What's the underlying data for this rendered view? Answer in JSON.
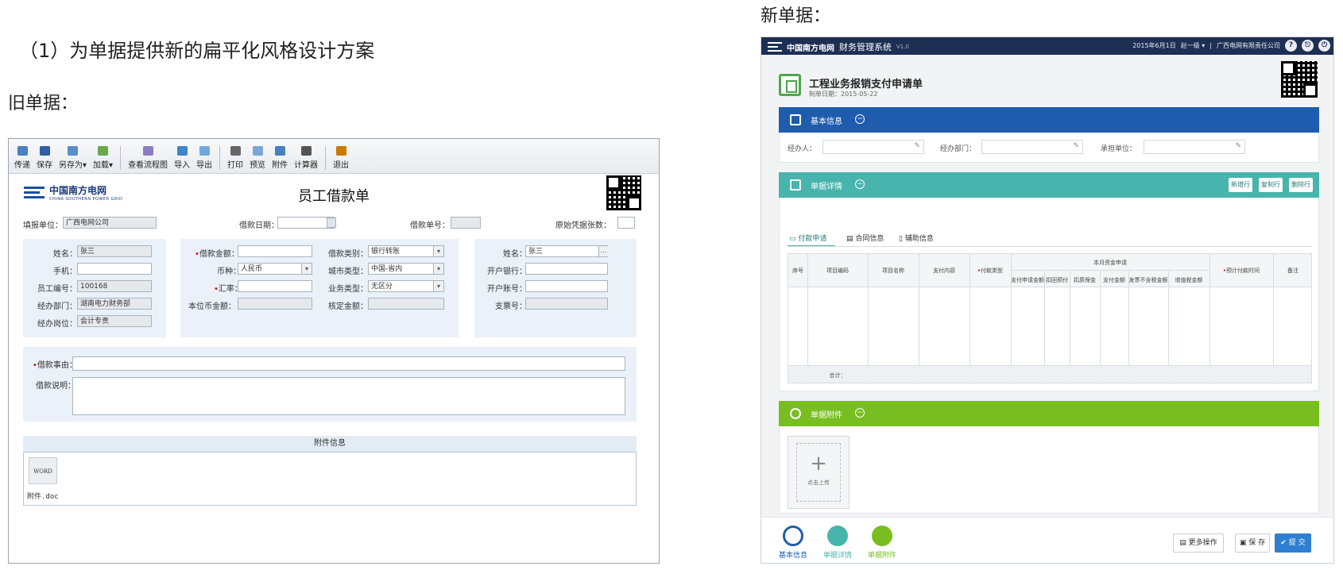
{
  "headings": {
    "main": "（1）为单据提供新的扁平化风格设计方案",
    "old_label": "旧单据：",
    "new_label": "新单据："
  },
  "old_form": {
    "toolbar": [
      "传递",
      "保存",
      "另存为▾",
      "加载▾",
      "查看流程图",
      "导入",
      "导出",
      "打印",
      "预览",
      "附件",
      "计算器",
      "退出"
    ],
    "logo_text": "中国南方电网",
    "logo_sub": "CHINA SOUTHERN POWER GRID",
    "title": "员工借款单",
    "header": {
      "unit_label": "填报单位：",
      "unit_value": "广西电网公司",
      "date_label": "借款日期：",
      "number_label": "借款单号：",
      "voucher_label": "原始凭据张数："
    },
    "left_panel": {
      "name_label": "姓名：",
      "name_value": "张三",
      "phone_label": "手机：",
      "empno_label": "员工编号：",
      "empno_value": "100168",
      "dept_label": "经办部门：",
      "dept_value": "湖南电力财务部",
      "post_label": "经办岗位：",
      "post_value": "会计专责"
    },
    "mid_panel": {
      "amount_label": "借款金额：",
      "type_label": "借款类别：",
      "type_value": "银行转账",
      "currency_label": "币种：",
      "currency_value": "人民币",
      "city_label": "城市类型：",
      "city_value": "中国-省内",
      "rate_label": "汇率：",
      "biz_label": "业务类型：",
      "biz_value": "无区分",
      "local_label": "本位币金额：",
      "check_label": "核定金额："
    },
    "right_panel": {
      "name_label": "姓名：",
      "name_value": "张三",
      "bank_label": "开户银行：",
      "account_label": "开户账号：",
      "check_label": "支票号："
    },
    "reason_label": "借款事由：",
    "desc_label": "借款说明：",
    "attach_title": "附件信息",
    "attach_icon": "WORD",
    "attach_file": "附件.doc"
  },
  "new_form": {
    "nav": {
      "logo": "中国南方电网",
      "system": "财务管理系统",
      "version": "V1.0",
      "date": "2015年6月1日",
      "user": "赵一级 ▾",
      "sep": "|",
      "company": "广西电网有限责任公司",
      "icons": [
        "?",
        "⎋",
        "⏻"
      ]
    },
    "title": "工程业务报销支付申请单",
    "date": "制单日期：2015-05-22",
    "basic": {
      "title": "基本信息",
      "handler": "经办人：",
      "dept": "经办部门：",
      "unit": "承担单位："
    },
    "details": {
      "title": "单据详情",
      "buttons": [
        "新增行",
        "复制行",
        "删除行"
      ],
      "tabs": [
        "付款申请",
        "合同信息",
        "辅助信息"
      ],
      "columns": [
        "序号",
        "项目编码",
        "项目名称",
        "支付内容",
        "付款类型",
        "本月资金申请",
        "预计付款时间",
        "备注"
      ],
      "sub_columns": [
        "支付申请金额",
        "扣回预付",
        "扣质保金",
        "支付金额",
        "发票不含税金额",
        "增值税金额"
      ],
      "total": "合计："
    },
    "attach": {
      "title": "单据附件",
      "upload": "点击上传",
      "plus": "+"
    },
    "bottom": {
      "nav": [
        "基本信息",
        "单据详情",
        "单据附件"
      ],
      "more": "更多操作",
      "save": "保 存",
      "submit": "提 交"
    },
    "colors": {
      "nav": "#1d2f53",
      "blue": "#1f5cae",
      "teal": "#47b4ad",
      "green": "#78be20",
      "submit": "#2e7fd1"
    }
  }
}
